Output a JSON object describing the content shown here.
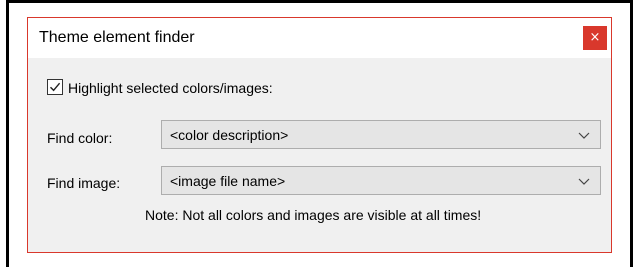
{
  "window": {
    "title": "Theme element finder",
    "close_glyph": "×",
    "accent_color": "#d9382c"
  },
  "highlight": {
    "label": "Highlight selected colors/images:",
    "checked": true
  },
  "find_color": {
    "label": "Find color:",
    "value": "<color description>"
  },
  "find_image": {
    "label": "Find image:",
    "value": "<image file name>"
  },
  "note": "Note: Not all colors and images are visible at all times!",
  "icons": {
    "dropdown": "chevron-down-icon",
    "check": "check-icon",
    "close": "close-icon"
  }
}
